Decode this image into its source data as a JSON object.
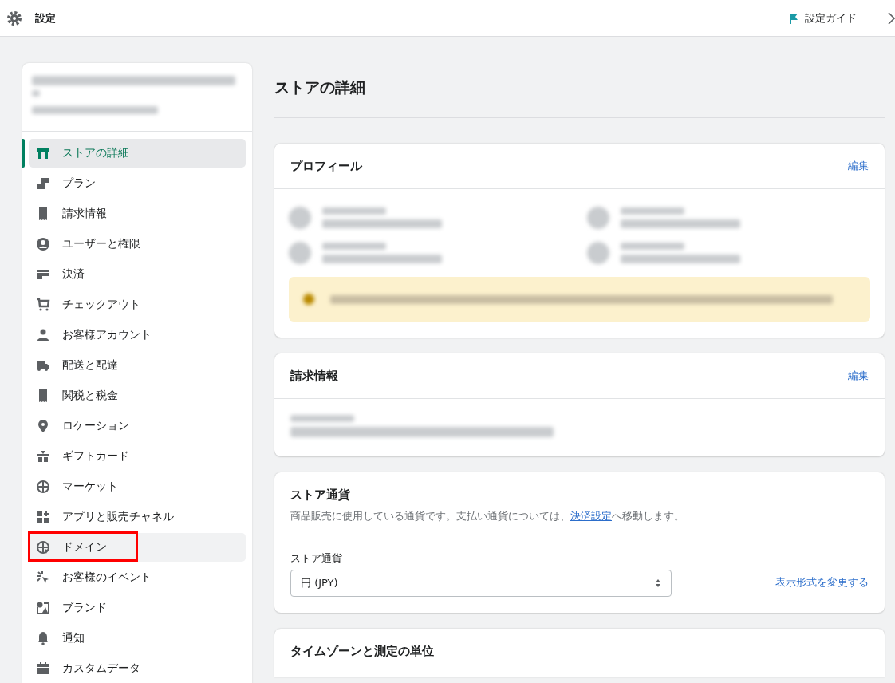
{
  "top_bar": {
    "title": "設定",
    "guide_link": "設定ガイド"
  },
  "sidebar": {
    "items": [
      {
        "label": "ストアの詳細",
        "selected": true,
        "hovered": false,
        "annotated": false
      },
      {
        "label": "プラン",
        "selected": false,
        "hovered": false,
        "annotated": false
      },
      {
        "label": "請求情報",
        "selected": false,
        "hovered": false,
        "annotated": false
      },
      {
        "label": "ユーザーと権限",
        "selected": false,
        "hovered": false,
        "annotated": false
      },
      {
        "label": "決済",
        "selected": false,
        "hovered": false,
        "annotated": false
      },
      {
        "label": "チェックアウト",
        "selected": false,
        "hovered": false,
        "annotated": false
      },
      {
        "label": "お客様アカウント",
        "selected": false,
        "hovered": false,
        "annotated": false
      },
      {
        "label": "配送と配達",
        "selected": false,
        "hovered": false,
        "annotated": false
      },
      {
        "label": "関税と税金",
        "selected": false,
        "hovered": false,
        "annotated": false
      },
      {
        "label": "ロケーション",
        "selected": false,
        "hovered": false,
        "annotated": false
      },
      {
        "label": "ギフトカード",
        "selected": false,
        "hovered": false,
        "annotated": false
      },
      {
        "label": "マーケット",
        "selected": false,
        "hovered": false,
        "annotated": false
      },
      {
        "label": "アプリと販売チャネル",
        "selected": false,
        "hovered": false,
        "annotated": false
      },
      {
        "label": "ドメイン",
        "selected": false,
        "hovered": true,
        "annotated": true
      },
      {
        "label": "お客様のイベント",
        "selected": false,
        "hovered": false,
        "annotated": false
      },
      {
        "label": "ブランド",
        "selected": false,
        "hovered": false,
        "annotated": false
      },
      {
        "label": "通知",
        "selected": false,
        "hovered": false,
        "annotated": false
      },
      {
        "label": "カスタムデータ",
        "selected": false,
        "hovered": false,
        "annotated": false
      }
    ]
  },
  "page_title": "ストアの詳細",
  "profile_card": {
    "title": "プロフィール",
    "edit_link": "編集"
  },
  "billing_card": {
    "title": "請求情報",
    "edit_link": "編集"
  },
  "currency_card": {
    "title": "ストア通貨",
    "description_before": "商品販売に使用している通貨です。支払い通貨については、",
    "description_link": "決済設定",
    "description_after": "へ移動します。",
    "field_label": "ストア通貨",
    "field_value": "円 (JPY)",
    "format_link": "表示形式を変更する"
  },
  "timezone_card": {
    "title": "タイムゾーンと測定の単位"
  }
}
